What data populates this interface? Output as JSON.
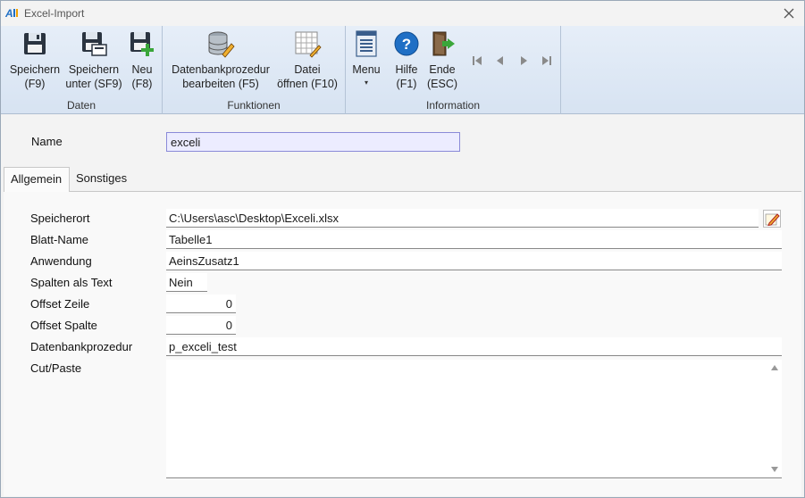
{
  "window": {
    "title": "Excel-Import"
  },
  "ribbon": {
    "groups": [
      {
        "label": "Daten"
      },
      {
        "label": "Funktionen"
      },
      {
        "label": "Information"
      }
    ],
    "buttons": {
      "save": {
        "line1": "Speichern",
        "line2": "(F9)"
      },
      "save_as": {
        "line1": "Speichern",
        "line2": "unter (SF9)"
      },
      "new": {
        "line1": "Neu",
        "line2": "(F8)"
      },
      "db_proc": {
        "line1": "Datenbankprozedur",
        "line2": "bearbeiten (F5)"
      },
      "open_file": {
        "line1": "Datei",
        "line2": "öffnen (F10)"
      },
      "menu": {
        "line1": "Menu",
        "arrow": "▾"
      },
      "help": {
        "line1": "Hilfe",
        "line2": "(F1)"
      },
      "end": {
        "line1": "Ende",
        "line2": "(ESC)"
      }
    }
  },
  "form": {
    "name_label": "Name",
    "name_value": "exceli"
  },
  "tabs": [
    {
      "label": "Allgemein",
      "active": true
    },
    {
      "label": "Sonstiges",
      "active": false
    }
  ],
  "fields": {
    "speicherort": {
      "label": "Speicherort",
      "value": "C:\\Users\\asc\\Desktop\\Exceli.xlsx"
    },
    "blatt_name": {
      "label": "Blatt-Name",
      "value": "Tabelle1"
    },
    "anwendung": {
      "label": "Anwendung",
      "value": "AeinsZusatz1"
    },
    "spalten_als_text": {
      "label": "Spalten als Text",
      "value": "Nein"
    },
    "offset_zeile": {
      "label": "Offset Zeile",
      "value": "0"
    },
    "offset_spalte": {
      "label": "Offset Spalte",
      "value": "0"
    },
    "datenbankprozedur": {
      "label": "Datenbankprozedur",
      "value": "p_exceli_test"
    },
    "cut_paste": {
      "label": "Cut/Paste",
      "value": ""
    }
  },
  "colors": {
    "ribbon_top": "#e6eef8",
    "ribbon_bottom": "#d7e3f2",
    "name_field_bg": "#ececff",
    "accent_blue": "#1f6fc5"
  }
}
